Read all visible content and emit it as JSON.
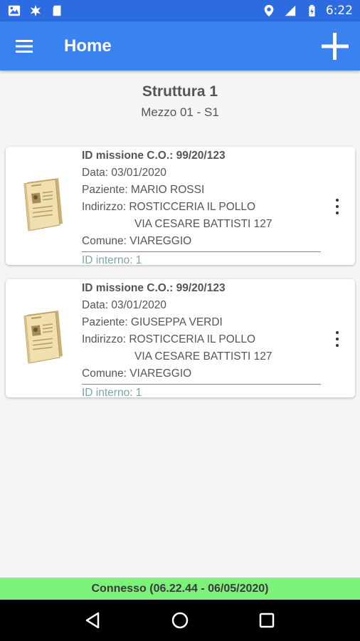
{
  "status_bar": {
    "time": "6:22",
    "network": "LTE",
    "icons": [
      "photo-icon",
      "debug-icon",
      "sd-card-icon",
      "location-icon",
      "signal-icon",
      "battery-icon"
    ]
  },
  "app_bar": {
    "title": "Home",
    "menu_icon": "menu-icon",
    "add_icon": "plus-icon",
    "color": "#3a82f0"
  },
  "header": {
    "struttura": "Struttura 1",
    "mezzo": "Mezzo 01 - S1"
  },
  "missions": [
    {
      "id_line": "ID missione C.O.: 99/20/123",
      "data": "Data: 03/01/2020",
      "paziente": "Paziente: MARIO ROSSI",
      "indirizzo_1": "Indirizzo: ROSTICCERIA IL POLLO",
      "indirizzo_2": "VIA CESARE BATTISTI 127",
      "comune": "Comune: VIAREGGIO",
      "id_interno": "ID interno: 1"
    },
    {
      "id_line": "ID missione C.O.: 99/20/123",
      "data": "Data: 03/01/2020",
      "paziente": "Paziente: GIUSEPPA VERDI",
      "indirizzo_1": "Indirizzo: ROSTICCERIA IL POLLO",
      "indirizzo_2": "VIA CESARE BATTISTI 127",
      "comune": "Comune: VIAREGGIO",
      "id_interno": "ID interno: 1"
    }
  ],
  "connection": {
    "text": "Connesso (06.22.44 - 06/05/2020)",
    "color": "#7cf27a"
  },
  "nav": {
    "icons": [
      "back-icon",
      "home-icon",
      "recents-icon"
    ]
  }
}
